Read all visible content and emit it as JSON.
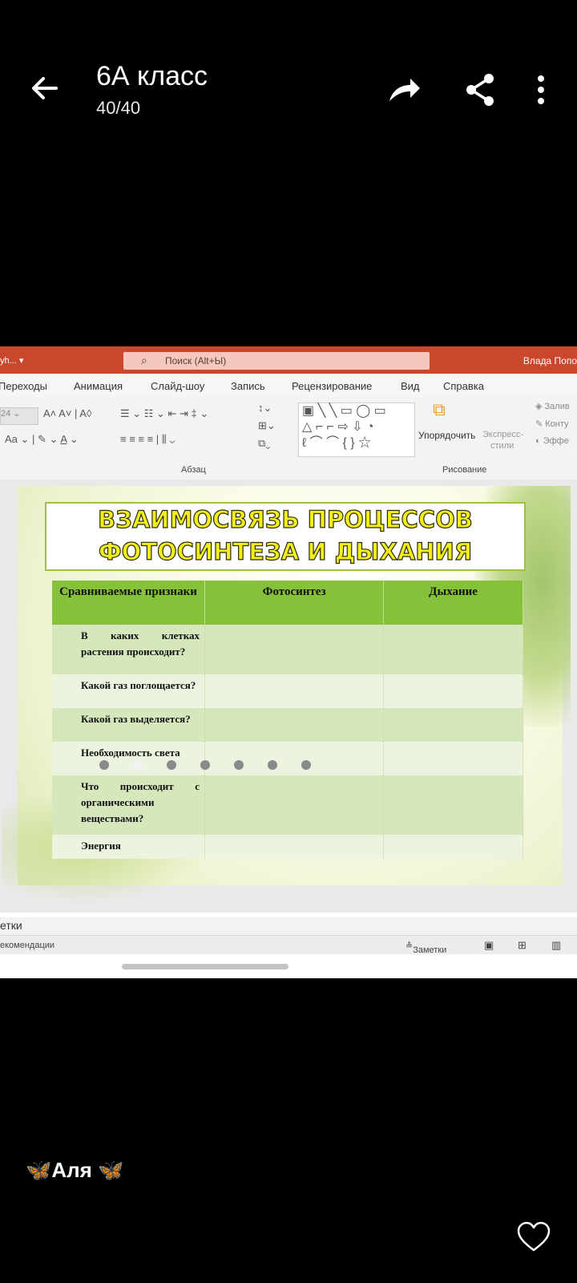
{
  "header": {
    "title": "6А класс",
    "counter": "40/40",
    "icons": [
      "back-arrow-icon",
      "forward-icon",
      "share-icon",
      "more-icon"
    ]
  },
  "ppt": {
    "doc_name": "yh... ▾",
    "search_placeholder": "Поиск (Alt+Ы)",
    "user": "Влада Попо",
    "tabs": [
      "Переходы",
      "Анимация",
      "Слайд-шоу",
      "Запись",
      "Рецензирование",
      "Вид",
      "Справка"
    ],
    "ribbon": {
      "font_size": "24",
      "group_paragraph": "Абзац",
      "group_drawing": "Рисование",
      "arrange": "Упорядочить",
      "express": "Экспресс-",
      "styles": "стили",
      "fill": "Залив",
      "outline": "Конту",
      "effects": "Эффе"
    },
    "slide": {
      "title_line1": "ВЗАИМОСВЯЗЬ ПРОЦЕССОВ",
      "title_line2": "ФОТОСИНТЕЗА И ДЫХАНИЯ",
      "table": {
        "headers": [
          "Сравниваемые признаки",
          "Фотосинтез",
          "Дыхание"
        ],
        "rows": [
          "В каких клетках растения происходит?",
          "Какой газ поглощается?",
          "Какой газ выделяется?",
          "Необходимость света",
          "Что происходит с органическими веществами?",
          "Энергия"
        ]
      }
    },
    "notes_label": "Заметки",
    "notes_partial": "етки",
    "status_left": "екомендации",
    "status_notes": "Заметки",
    "slide_dots": 7,
    "active_dot": 2
  },
  "author": "🦋Аля 🦋",
  "colors": {
    "ppt_red": "#c8472d",
    "table_header_green": "#86c13a",
    "title_yellow": "#f3ee1a"
  }
}
